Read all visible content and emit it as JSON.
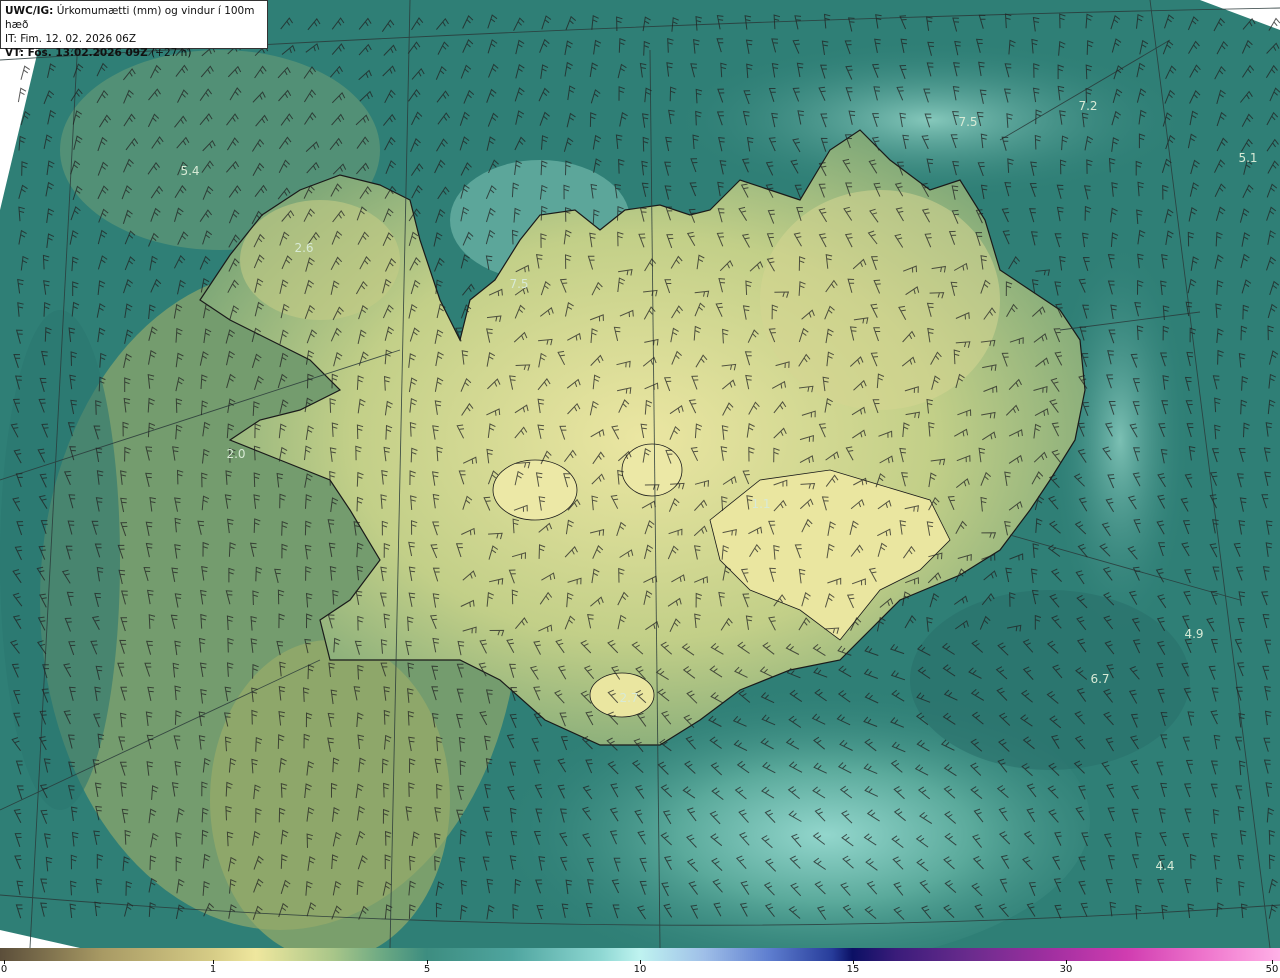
{
  "title": {
    "line1_bold": "UWC/IG:",
    "line1_rest": "Úrkomumætti (mm) og vindur í 100m hæð",
    "line2": "IT: Fim. 12. 02. 2026 06Z",
    "line3_bold": "VT: Fös. 13.02.2026 09Z",
    "line3_rest": "(+27 h)"
  },
  "map_values": [
    "5.4",
    "2.6",
    "7.5",
    "7.5",
    "7.2",
    "5.1",
    "2.0",
    "1.1",
    "2.7",
    "4.9",
    "6.7",
    "4.4"
  ],
  "legend": {
    "ticks": [
      "0",
      "1",
      "5",
      "10",
      "15",
      "30",
      "50"
    ],
    "colors": {
      "dry": "#efe79e",
      "medium": "#3d8d80",
      "wet": "#bff3f0",
      "heavy": "#0b1064",
      "extreme": "#ffb0e6"
    }
  },
  "colors": {
    "land": "#b8c77f",
    "land_highlight": "#e6e39a",
    "sea_base": "#2f7f76",
    "sea_light": "#7fc6bd",
    "coastline": "#1a1a1a",
    "barb": "#222222"
  }
}
